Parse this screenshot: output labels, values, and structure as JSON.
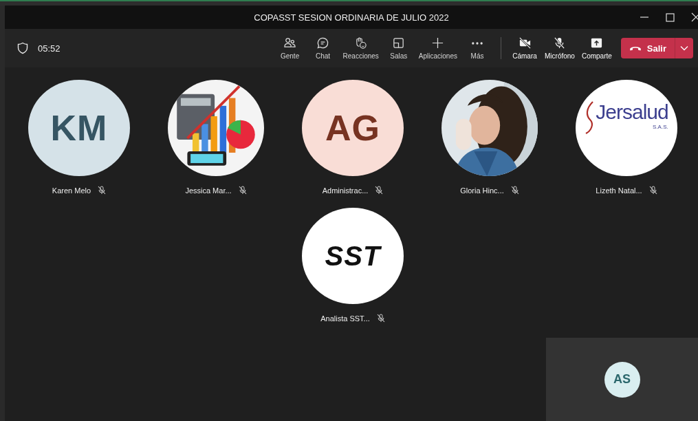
{
  "window": {
    "title": "COPASST SESION ORDINARIA DE JULIO 2022"
  },
  "toolbar": {
    "timer": "05:52",
    "items": [
      {
        "kind": "people",
        "label": "Gente"
      },
      {
        "kind": "chat",
        "label": "Chat"
      },
      {
        "kind": "reactions",
        "label": "Reacciones"
      },
      {
        "kind": "rooms",
        "label": "Salas"
      },
      {
        "kind": "apps",
        "label": "Aplicaciones"
      },
      {
        "kind": "more",
        "label": "Más"
      },
      {
        "kind": "camera",
        "label": "Cámara",
        "on": false
      },
      {
        "kind": "mic",
        "label": "Micrófono",
        "on": false
      },
      {
        "kind": "share",
        "label": "Comparte"
      }
    ],
    "leave_button": {
      "label": "Salir"
    }
  },
  "participants": [
    {
      "name": "Karen Melo",
      "muted": true,
      "avatar": {
        "kind": "initials",
        "text": "KM",
        "color": "#d5e2e8"
      }
    },
    {
      "name": "Jessica Mar...",
      "muted": true
    },
    {
      "name": "Administrac...",
      "muted": true,
      "avatar": {
        "kind": "initials",
        "text": "AG",
        "color": "#f9ddd6"
      }
    },
    {
      "name": "Gloria Hinc...",
      "muted": true
    },
    {
      "name": "Lizeth Natal...",
      "muted": true,
      "avatar": {
        "kind": "script_logo",
        "text": "Jersalud",
        "subtext": "S.A.S."
      }
    },
    {
      "name": "Analista SST...",
      "muted": true,
      "avatar": {
        "kind": "block_logo",
        "text": "SST"
      }
    }
  ],
  "self_view": {
    "avatar": {
      "kind": "initials",
      "text": "AS",
      "color": "#d9eef0"
    }
  }
}
